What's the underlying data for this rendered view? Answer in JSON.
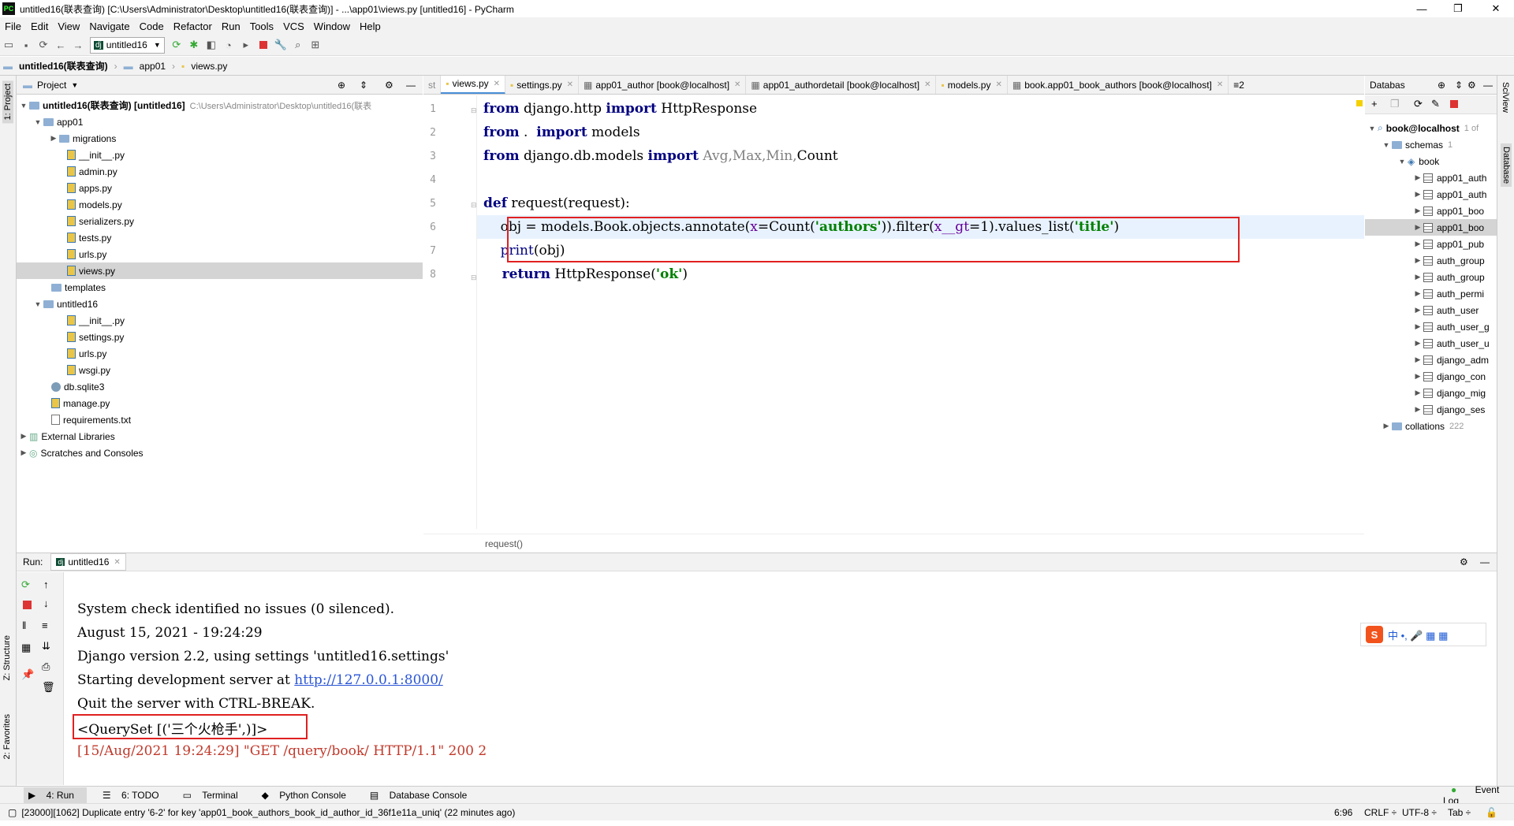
{
  "window": {
    "title": "untitled16(联表查询) [C:\\Users\\Administrator\\Desktop\\untitled16(联表查询)] - ...\\app01\\views.py [untitled16] - PyCharm",
    "app_icon": "PC"
  },
  "menu": [
    "File",
    "Edit",
    "View",
    "Navigate",
    "Code",
    "Refactor",
    "Run",
    "Tools",
    "VCS",
    "Window",
    "Help"
  ],
  "toolbar": {
    "run_config": "untitled16"
  },
  "navbar": [
    "untitled16(联表查询)",
    "app01",
    "views.py"
  ],
  "project": {
    "header": "Project",
    "tree": [
      {
        "label": "untitled16(联表查询) [untitled16]",
        "path": "C:\\Users\\Administrator\\Desktop\\untitled16(联表",
        "type": "folder",
        "open": true
      },
      {
        "label": "app01",
        "type": "folder",
        "open": true
      },
      {
        "label": "migrations",
        "type": "folder",
        "open": false
      },
      {
        "label": "__init__.py",
        "type": "py"
      },
      {
        "label": "admin.py",
        "type": "py"
      },
      {
        "label": "apps.py",
        "type": "py"
      },
      {
        "label": "models.py",
        "type": "py"
      },
      {
        "label": "serializers.py",
        "type": "py"
      },
      {
        "label": "tests.py",
        "type": "py"
      },
      {
        "label": "urls.py",
        "type": "py"
      },
      {
        "label": "views.py",
        "type": "py",
        "selected": true
      },
      {
        "label": "templates",
        "type": "folder"
      },
      {
        "label": "untitled16",
        "type": "folder",
        "open": true
      },
      {
        "label": "__init__.py",
        "type": "py"
      },
      {
        "label": "settings.py",
        "type": "py"
      },
      {
        "label": "urls.py",
        "type": "py"
      },
      {
        "label": "wsgi.py",
        "type": "py"
      },
      {
        "label": "db.sqlite3",
        "type": "db"
      },
      {
        "label": "manage.py",
        "type": "py"
      },
      {
        "label": "requirements.txt",
        "type": "txt"
      },
      {
        "label": "External Libraries",
        "type": "lib",
        "open": false
      },
      {
        "label": "Scratches and Consoles",
        "type": "lib",
        "open": false
      }
    ]
  },
  "tabs": [
    "st",
    "views.py",
    "settings.py",
    "app01_author [book@localhost]",
    "app01_authordetail [book@localhost]",
    "models.py",
    "book.app01_book_authors [book@localhost]"
  ],
  "tab_overflow": "≡2",
  "editor": {
    "line_numbers": [
      "1",
      "2",
      "3",
      "4",
      "5",
      "6",
      "7",
      "8"
    ],
    "l1": {
      "a": "from",
      "b": " django.http ",
      "c": "import",
      "d": " HttpResponse"
    },
    "l2": {
      "a": "from",
      "b": " .  ",
      "c": "import",
      "d": " models"
    },
    "l3": {
      "a": "from",
      "b": " django.db.models ",
      "c": "import",
      "d": " Avg,Max,Min,",
      "e": "Count"
    },
    "l5": {
      "a": "def",
      "b": " request(request):"
    },
    "l6": {
      "a": "    obj = models.Book.objects.annotate(",
      "b": "x",
      "c": "=Count(",
      "d": "'authors'",
      "e": ")).filter(",
      "f": "x__gt",
      "g": "=1).values_list(",
      "h": "'title'",
      "i": ")"
    },
    "l7": {
      "a": "    print",
      "b": "(obj)"
    },
    "l8": {
      "a": "    return",
      "b": " HttpResponse(",
      "c": "'ok'",
      "d": ")"
    },
    "breadcrumb": "request()"
  },
  "database": {
    "header": "Databas",
    "root": "book@localhost",
    "root_count": "1 of",
    "schemas": "schemas",
    "schemas_count": "1",
    "schema": "book",
    "tables": [
      "app01_auth",
      "app01_auth",
      "app01_boo",
      "app01_boo",
      "app01_pub",
      "auth_group",
      "auth_group",
      "auth_permi",
      "auth_user",
      "auth_user_g",
      "auth_user_u",
      "django_adm",
      "django_con",
      "django_mig",
      "django_ses"
    ],
    "collations": "collations",
    "collations_count": "222"
  },
  "run": {
    "label": "Run:",
    "tab": "untitled16",
    "lines": [
      "System check identified no issues (0 silenced).",
      "August 15, 2021 - 19:24:29",
      "Django version 2.2, using settings 'untitled16.settings'",
      "Starting development server at ",
      "Quit the server with CTRL-BREAK.",
      "<QuerySet [('三个火枪手',)]>",
      "[15/Aug/2021 19:24:29] \"GET /query/book/ HTTP/1.1\" 200 2"
    ],
    "link": "http://127.0.0.1:8000/"
  },
  "ime": {
    "logo": "S",
    "text": "中 •, 🎤 ▦ ▦"
  },
  "bottom_tabs": [
    "4: Run",
    "6: TODO",
    "Terminal",
    "Python Console",
    "Database Console"
  ],
  "event_log": "Event Log",
  "status": {
    "message": "[23000][1062] Duplicate entry '6-2' for key 'app01_book_authors_book_id_author_id_36f1e11a_uniq' (22 minutes ago)",
    "position": "6:96",
    "line_sep": "CRLF ÷",
    "encoding": "UTF-8 ÷",
    "indent": "Tab ÷"
  },
  "side": {
    "project": "1: Project",
    "structure": "Z: Structure",
    "favorites": "2: Favorites",
    "sciview": "SciView",
    "database": "Database"
  },
  "colors": {
    "keyword": "#000080",
    "string": "#008000",
    "param": "#660099",
    "highlight": "#e02020"
  }
}
